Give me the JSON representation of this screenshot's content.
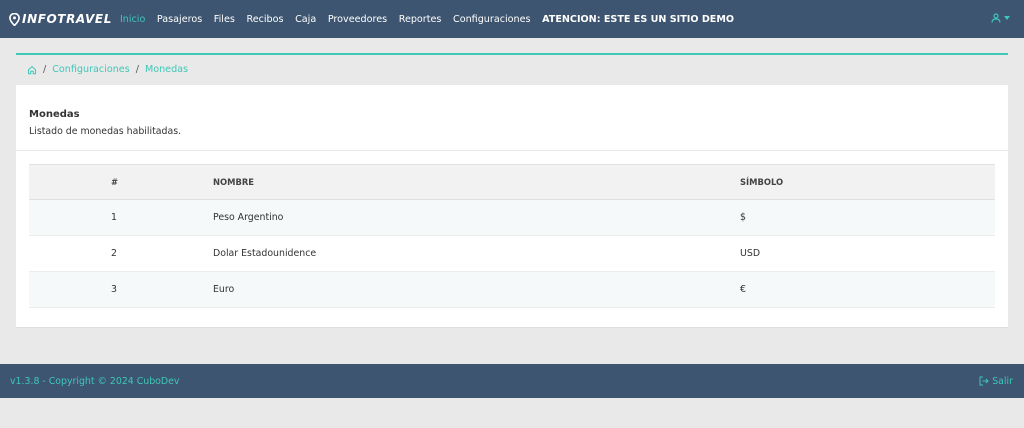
{
  "brand": {
    "name": "INFOTRAVEL"
  },
  "nav": {
    "items": [
      {
        "label": "Inicio"
      },
      {
        "label": "Pasajeros"
      },
      {
        "label": "Files"
      },
      {
        "label": "Recibos"
      },
      {
        "label": "Caja"
      },
      {
        "label": "Proveedores"
      },
      {
        "label": "Reportes"
      },
      {
        "label": "Configuraciones"
      }
    ],
    "warning": "ATENCION: ESTE ES UN SITIO DEMO"
  },
  "breadcrumb": {
    "sep": "/",
    "level1": "Configuraciones",
    "level2": "Monedas"
  },
  "card": {
    "title": "Monedas",
    "description": "Listado de monedas habilitadas."
  },
  "table": {
    "headers": [
      "#",
      "NOMBRE",
      "SÍMBOLO"
    ],
    "rows": [
      [
        "1",
        "Peso Argentino",
        "$"
      ],
      [
        "2",
        "Dolar Estadounidence",
        "USD"
      ],
      [
        "3",
        "Euro",
        "€"
      ]
    ]
  },
  "footer": {
    "text": "v1.3.8 - Copyright © 2024 CuboDev",
    "logout": "Salir"
  },
  "colors": {
    "accent": "#3fc7b7",
    "topbar": "#3d5570",
    "background": "#e9e9e9"
  }
}
